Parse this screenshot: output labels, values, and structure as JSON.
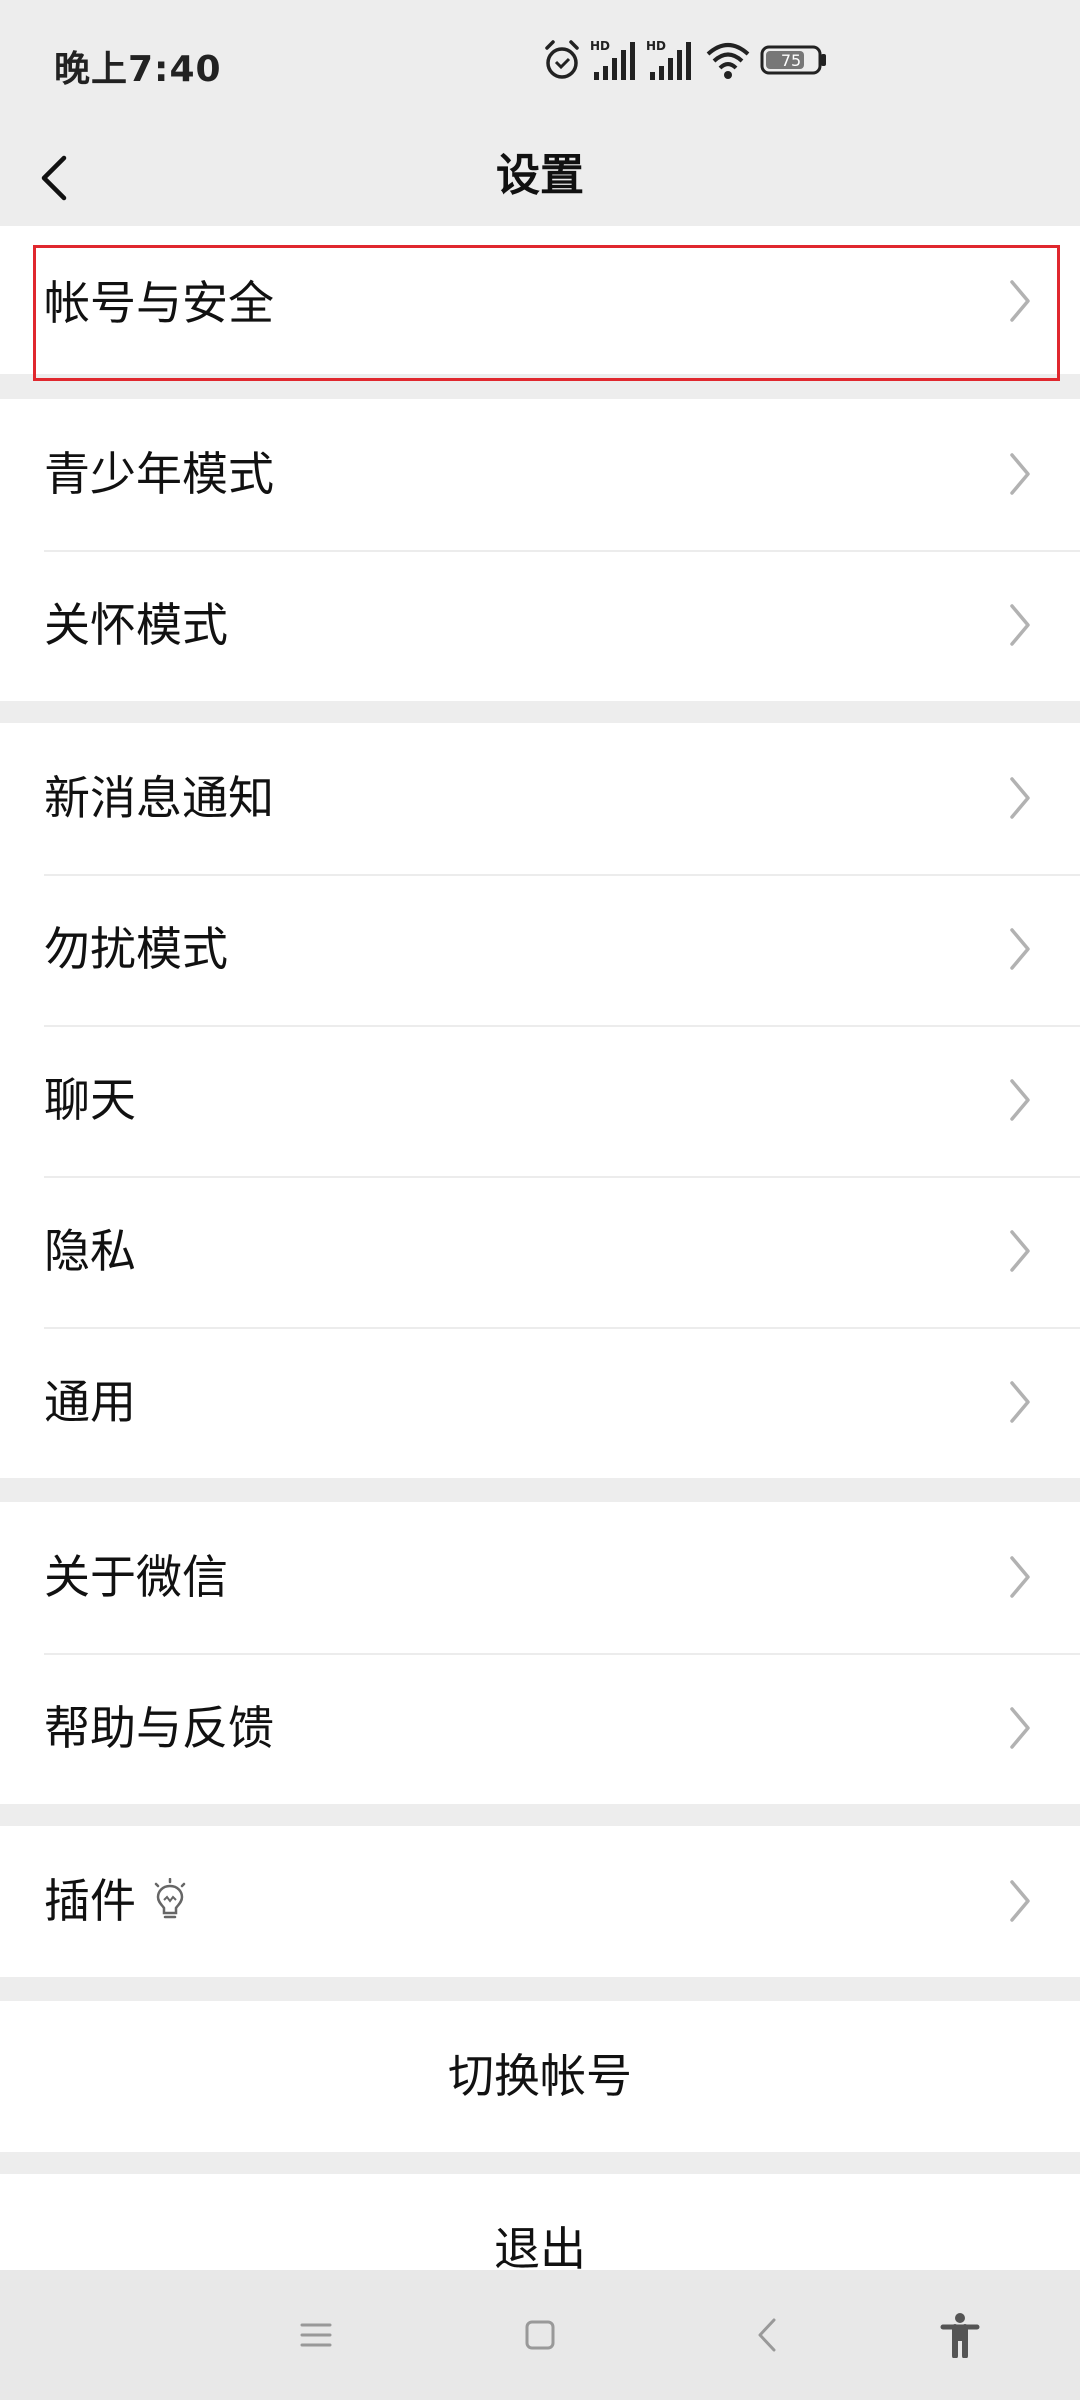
{
  "status_bar": {
    "time": "晚上7:40",
    "signal_label_1": "HD",
    "signal_label_2": "HD",
    "battery": "75"
  },
  "header": {
    "title": "设置"
  },
  "groups": [
    {
      "items": [
        {
          "label": "帐号与安全"
        }
      ]
    },
    {
      "items": [
        {
          "label": "青少年模式"
        },
        {
          "label": "关怀模式"
        }
      ]
    },
    {
      "items": [
        {
          "label": "新消息通知"
        },
        {
          "label": "勿扰模式"
        },
        {
          "label": "聊天"
        },
        {
          "label": "隐私"
        },
        {
          "label": "通用"
        }
      ]
    },
    {
      "items": [
        {
          "label": "关于微信"
        },
        {
          "label": "帮助与反馈"
        }
      ]
    },
    {
      "items": [
        {
          "label": "插件"
        }
      ]
    }
  ],
  "actions": {
    "switch_account": "切换帐号",
    "logout": "退出"
  },
  "colors": {
    "background": "#ededed",
    "highlight": "#e0282e",
    "chevron": "#b2b2b2"
  }
}
